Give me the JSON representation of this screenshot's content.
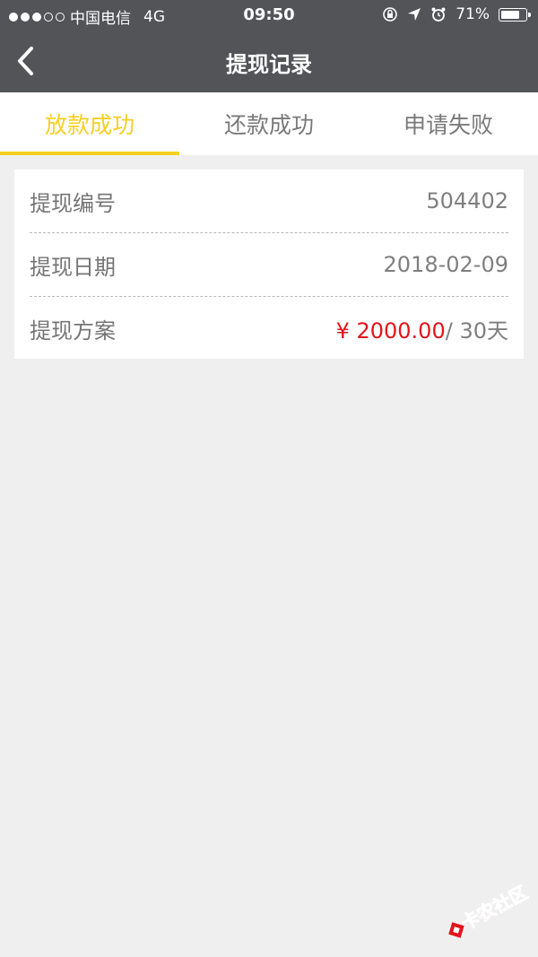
{
  "status_bar": {
    "carrier": "中国电信",
    "network": "4G",
    "time": "09:50",
    "battery": "71%"
  },
  "nav": {
    "title": "提现记录"
  },
  "tabs": [
    {
      "label": "放款成功",
      "active": true
    },
    {
      "label": "还款成功",
      "active": false
    },
    {
      "label": "申请失败",
      "active": false
    }
  ],
  "record": {
    "number_label": "提现编号",
    "number_value": "504402",
    "date_label": "提现日期",
    "date_value": "2018-02-09",
    "plan_label": "提现方案",
    "plan_amount": "¥ 2000.00",
    "plan_term": "/ 30天"
  },
  "watermark": {
    "text": "卡农社区"
  },
  "colors": {
    "header_bg": "#535458",
    "accent": "#f7cf22",
    "price": "#e3141b",
    "page_bg": "#efeff0"
  }
}
